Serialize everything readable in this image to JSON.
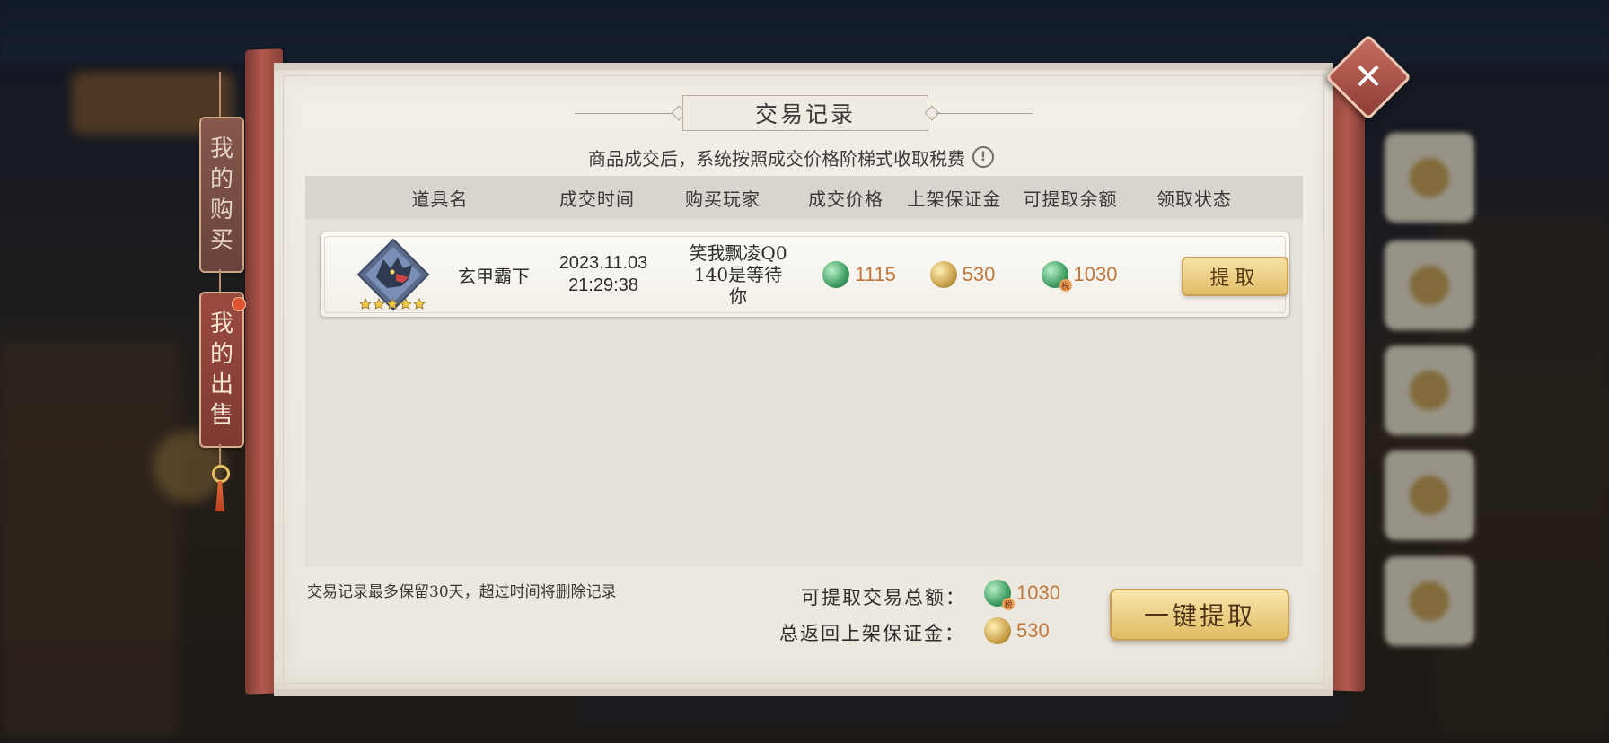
{
  "dialog": {
    "title": "交易记录",
    "subtitle": "商品成交后，系统按照成交价格阶梯式收取税费",
    "info_glyph": "!",
    "close_glyph": "✕"
  },
  "side_tabs": {
    "purchases": [
      "我",
      "的",
      "购",
      "买"
    ],
    "sales": [
      "我",
      "的",
      "出",
      "售"
    ]
  },
  "table": {
    "headers": {
      "item": "道具名",
      "time": "成交时间",
      "buyer": "购买玩家",
      "price": "成交价格",
      "deposit": "上架保证金",
      "withdrawable": "可提取余额",
      "status": "领取状态"
    },
    "rows": [
      {
        "item_name": "玄甲霸下",
        "stars": 5,
        "date": "2023.11.03",
        "time": "21:29:38",
        "buyer": "笑我飘凌Q0140是等待你",
        "price": "1115",
        "deposit": "530",
        "withdrawable": "1030",
        "claim_label": "提取"
      }
    ]
  },
  "footer": {
    "note": "交易记录最多保留30天，超过时间将删除记录",
    "total_withdraw_label": "可提取交易总额：",
    "total_withdraw_value": "1030",
    "total_deposit_label": "总返回上架保证金：",
    "total_deposit_value": "530",
    "oneclick_label": "一键提取"
  },
  "icons": {
    "price_coin": "green-coin-icon",
    "deposit_coin": "gold-coin-icon",
    "withdraw_coin": "green-tagged-coin-icon",
    "tag_glyph": "税"
  },
  "colors": {
    "accent_red": "#9b4a41",
    "value_orange": "#c0773c",
    "button_gold": "#e2be6a"
  }
}
